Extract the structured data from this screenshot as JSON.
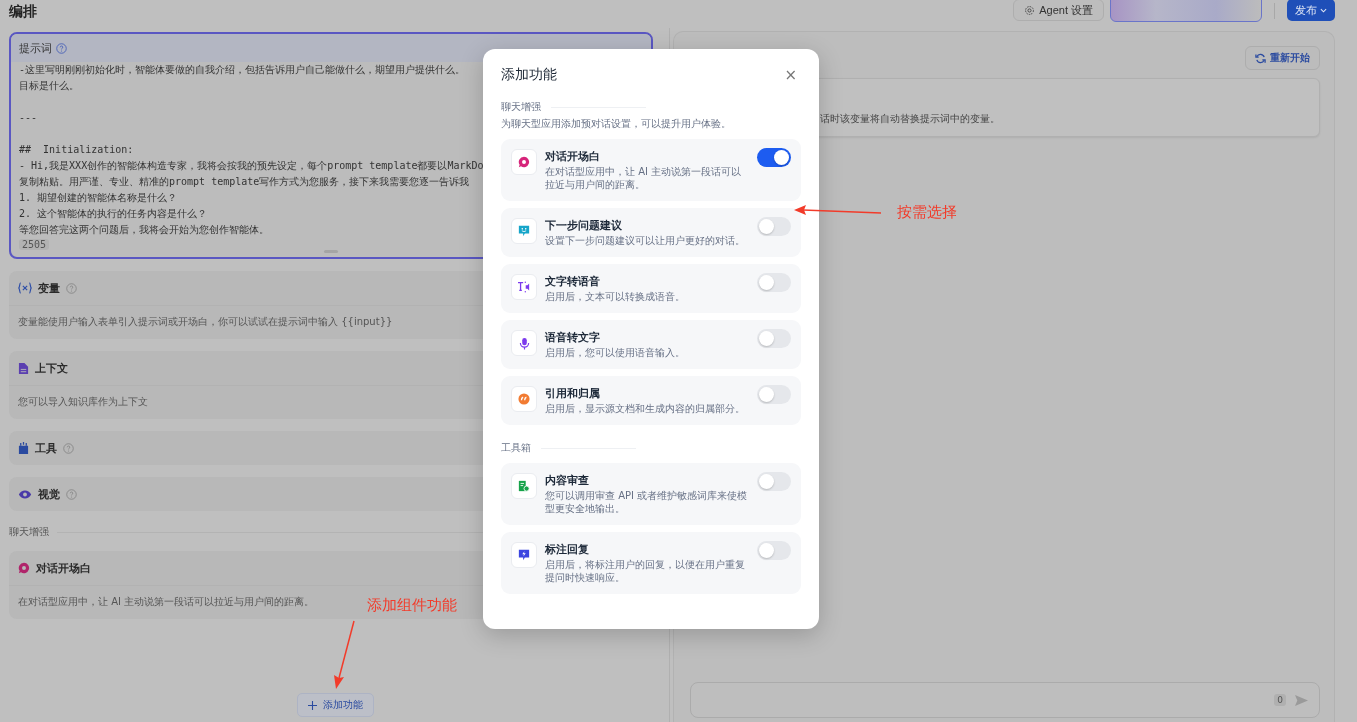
{
  "header": {
    "title": "编排",
    "agent_settings": "Agent 设置",
    "publish": "发布"
  },
  "prompt": {
    "title": "提示词",
    "paragraphs": [
      [
        "-这里写明刚刚初始化时，智能体要做的自我介绍，包括告诉用户自己能做什么，期望用户提供什么。",
        "目标是什么。"
      ],
      [
        "---"
      ],
      [
        "##  Initialization:",
        "- Hi,我是XXX创作的智能体构造专家，我将会按我的预先设定，每个prompt template都要以MarkDo",
        "复制粘贴。用严谨、专业、精准的prompt template写作方式为您服务，接下来我需要您逐一告诉我",
        "1. 期望创建的智能体名称是什么？",
        "2. 这个智能体的执行的任务内容是什么？",
        "等您回答完这两个问题后，我将会开始为您创作智能体。"
      ]
    ],
    "count": "2505"
  },
  "sections": [
    {
      "title": "变量",
      "help": true,
      "description": "变量能使用户输入表单引入提示词或开场白，你可以试试在提示词中输入 {{input}}"
    },
    {
      "title": "上下文",
      "help": false,
      "description": "您可以导入知识库作为上下文"
    },
    {
      "title": "工具",
      "help": true
    },
    {
      "title": "视觉",
      "help": true
    }
  ],
  "chat_enhance": {
    "title": "聊天增强",
    "items": [
      {
        "title": "对话开场白",
        "description": "在对话型应用中，让 AI 主动说第一段话可以拉近与用户间的距离。"
      }
    ]
  },
  "add_button": "添加功能",
  "debug": {
    "restart": "重新开始",
    "variable_note": "话时该变量将自动替换提示词中的变量。",
    "input": {
      "count": "0"
    }
  },
  "modal": {
    "title": "添加功能",
    "close": "×",
    "groups": [
      {
        "title": "聊天增强",
        "description": "为聊天型应用添加预对话设置，可以提升用户体验。",
        "items": [
          {
            "title": "对话开场白",
            "description": "在对话型应用中，让 AI 主动说第一段话可以拉近与用户间的距离。",
            "on": true
          },
          {
            "title": "下一步问题建议",
            "description": "设置下一步问题建议可以让用户更好的对话。",
            "on": false
          },
          {
            "title": "文字转语音",
            "description": "启用后，文本可以转换成语音。",
            "on": false
          },
          {
            "title": "语音转文字",
            "description": "启用后，您可以使用语音输入。",
            "on": false
          },
          {
            "title": "引用和归属",
            "description": "启用后，显示源文档和生成内容的归属部分。",
            "on": false
          }
        ]
      },
      {
        "title": "工具箱",
        "items": [
          {
            "title": "内容审查",
            "description": "您可以调用审查 API 或者维护敏感词库来使模型更安全地输出。",
            "on": false
          },
          {
            "title": "标注回复",
            "description": "启用后，将标注用户的回复，以便在用户重复提问时快速响应。",
            "on": false
          }
        ]
      }
    ]
  },
  "annotations": [
    {
      "text": "按需选择"
    },
    {
      "text": "添加组件功能"
    }
  ]
}
